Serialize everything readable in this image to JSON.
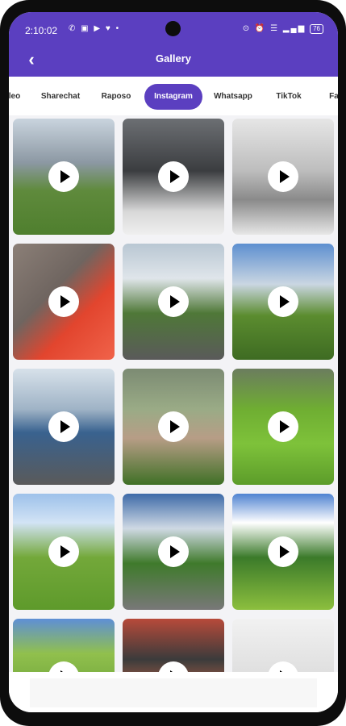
{
  "status": {
    "time": "2:10:02",
    "left_icons": "✆ ▣ ▶ ♥ •",
    "right_icons": "⊙ ⏰ ☰ ▂▄▆",
    "battery": "76"
  },
  "appbar": {
    "title": "Gallery",
    "back_icon": "arrow-left-icon"
  },
  "tabs": [
    {
      "label": "leo"
    },
    {
      "label": "Sharechat"
    },
    {
      "label": "Raposo"
    },
    {
      "label": "Instagram",
      "active": true
    },
    {
      "label": "Whatsapp"
    },
    {
      "label": "TikTok"
    },
    {
      "label": "Fa"
    }
  ],
  "thumbnails": [
    {
      "scene": "cows-mountains"
    },
    {
      "scene": "barbershop"
    },
    {
      "scene": "barber-shop-2"
    },
    {
      "scene": "red-chair"
    },
    {
      "scene": "mountain-road"
    },
    {
      "scene": "cabin-valley"
    },
    {
      "scene": "lake-mountains-road"
    },
    {
      "scene": "village-valley"
    },
    {
      "scene": "green-hills-sheep"
    },
    {
      "scene": "green-meadow"
    },
    {
      "scene": "road-snow-peaks"
    },
    {
      "scene": "valley-road-clouds"
    },
    {
      "scene": "green-fields"
    },
    {
      "scene": "face-mask"
    },
    {
      "scene": "room"
    }
  ],
  "colors": {
    "accent": "#5b3fc0",
    "play_bg": "#ffffff"
  }
}
